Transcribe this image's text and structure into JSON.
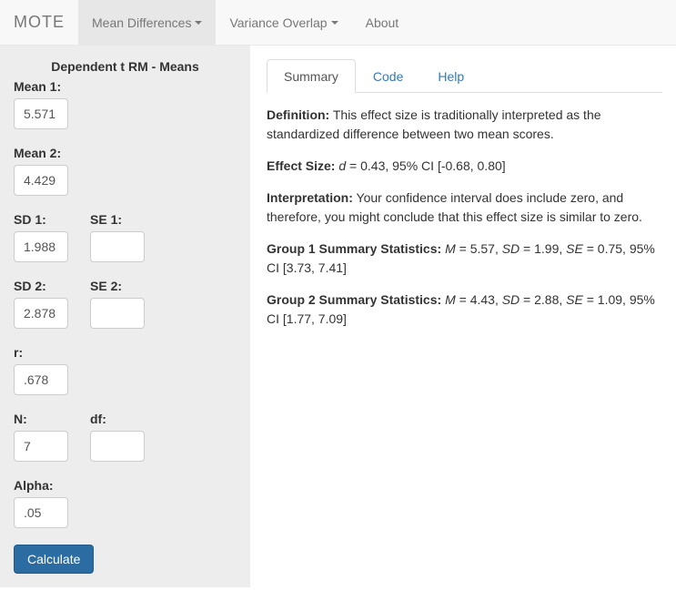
{
  "navbar": {
    "brand": "MOTE",
    "items": [
      {
        "label": "Mean Differences",
        "caret": true,
        "active": true
      },
      {
        "label": "Variance Overlap",
        "caret": true,
        "active": false
      },
      {
        "label": "About",
        "caret": false,
        "active": false
      }
    ]
  },
  "sidebar": {
    "title": "Dependent t RM - Means",
    "fields": {
      "mean1": {
        "label": "Mean 1:",
        "value": "5.571"
      },
      "mean2": {
        "label": "Mean 2:",
        "value": "4.429"
      },
      "sd1": {
        "label": "SD 1:",
        "value": "1.988"
      },
      "se1": {
        "label": "SE 1:",
        "value": ""
      },
      "sd2": {
        "label": "SD 2:",
        "value": "2.878"
      },
      "se2": {
        "label": "SE 2:",
        "value": ""
      },
      "r": {
        "label": "r:",
        "value": ".678"
      },
      "n": {
        "label": "N:",
        "value": "7"
      },
      "df": {
        "label": "df:",
        "value": ""
      },
      "alpha": {
        "label": "Alpha:",
        "value": ".05"
      }
    },
    "button": "Calculate"
  },
  "tabs": [
    {
      "label": "Summary",
      "active": true
    },
    {
      "label": "Code",
      "active": false
    },
    {
      "label": "Help",
      "active": false
    }
  ],
  "summary": {
    "definition_label": "Definition:",
    "definition_text": " This effect size is traditionally interpreted as the standardized difference between two mean scores.",
    "effect_label": "Effect Size:",
    "effect_d": "d",
    "effect_text": " = 0.43, 95% CI [-0.68, 0.80]",
    "interp_label": "Interpretation:",
    "interp_text": " Your confidence interval does include zero, and therefore, you might conclude that this effect size is similar to zero.",
    "g1_label": "Group 1 Summary Statistics:",
    "g1_M": "M",
    "g1_Mtext": " = 5.57, ",
    "g1_SD": "SD",
    "g1_SDtext": " = 1.99, ",
    "g1_SE": "SE",
    "g1_SEtext": " = 0.75, 95% CI [3.73, 7.41]",
    "g2_label": "Group 2 Summary Statistics:",
    "g2_M": "M",
    "g2_Mtext": " = 4.43, ",
    "g2_SD": "SD",
    "g2_SDtext": " = 2.88, ",
    "g2_SE": "SE",
    "g2_SEtext": " = 1.09, 95% CI [1.77, 7.09]"
  }
}
